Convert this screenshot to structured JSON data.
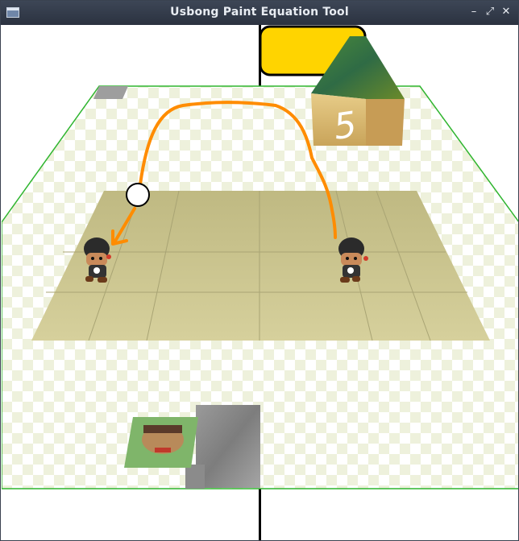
{
  "window": {
    "title": "Usbong Paint Equation Tool",
    "buttons": {
      "minimize": "–",
      "restore": "⤢",
      "close": "✕"
    }
  },
  "scene": {
    "colors": {
      "floor_border": "#2fb52f",
      "checker": "#eef1dc",
      "sand": "#c9c48e",
      "trajectory": "#ff8c00",
      "yellow_block": "#ffd400",
      "wall": "#000000"
    },
    "cube_number": "5",
    "icons": [
      "ball-icon",
      "character-icon",
      "cube-icon",
      "tile-icon"
    ]
  }
}
